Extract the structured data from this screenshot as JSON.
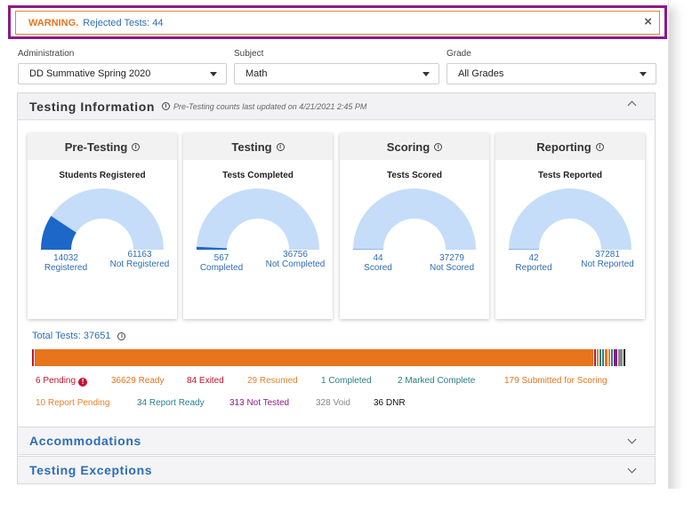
{
  "warning": {
    "label": "WARNING.",
    "message": "Rejected Tests: 44",
    "close_icon": "×"
  },
  "filters": [
    {
      "label": "Administration",
      "value": "DD Summative Spring 2020"
    },
    {
      "label": "Subject",
      "value": "Math"
    },
    {
      "label": "Grade",
      "value": "All Grades"
    }
  ],
  "testing_info": {
    "title": "Testing Information",
    "note": "Pre-Testing counts last updated on 4/21/2021 2:45 PM",
    "info_icon": "i",
    "cards": [
      {
        "title": "Pre-Testing",
        "subtitle": "Students Registered",
        "fraction": 0.1855,
        "left_value": "14032",
        "left_label": "Registered",
        "right_value": "61163",
        "right_label": "Not Registered"
      },
      {
        "title": "Testing",
        "subtitle": "Tests Completed",
        "fraction": 0.0152,
        "left_value": "567",
        "left_label": "Completed",
        "right_value": "36756",
        "right_label": "Not Completed"
      },
      {
        "title": "Scoring",
        "subtitle": "Tests Scored",
        "fraction": 0.0012,
        "left_value": "44",
        "left_label": "Scored",
        "right_value": "37279",
        "right_label": "Not Scored"
      },
      {
        "title": "Reporting",
        "subtitle": "Tests Reported",
        "fraction": 0.0011,
        "left_value": "42",
        "left_label": "Reported",
        "right_value": "37281",
        "right_label": "Not Reported"
      }
    ],
    "total_label": "Total Tests: 37651",
    "status_items": [
      {
        "count": 6,
        "label": "6 Pending",
        "color": "#c41230",
        "alert": true
      },
      {
        "count": 36629,
        "label": "36629 Ready",
        "color": "#e8741c"
      },
      {
        "count": 84,
        "label": "84 Exited",
        "color": "#c41230"
      },
      {
        "count": 29,
        "label": "29 Resumed",
        "color": "#e8822a"
      },
      {
        "count": 1,
        "label": "1 Completed",
        "color": "#2a7f88"
      },
      {
        "count": 2,
        "label": "2 Marked Complete",
        "color": "#2a7f88"
      },
      {
        "count": 179,
        "label": "179 Submitted for Scoring",
        "color": "#e8741c"
      },
      {
        "count": 10,
        "label": "10 Report Pending",
        "color": "#e8822a"
      },
      {
        "count": 34,
        "label": "34 Report Ready",
        "color": "#2a7f88"
      },
      {
        "count": 313,
        "label": "313 Not Tested",
        "color": "#8b1a86"
      },
      {
        "count": 328,
        "label": "328 Void",
        "color": "#888888"
      },
      {
        "count": 36,
        "label": "36 DNR",
        "color": "#111111"
      }
    ]
  },
  "sections": [
    {
      "title": "Accommodations"
    },
    {
      "title": "Testing Exceptions"
    }
  ],
  "colors": {
    "gauge_fill": "#1c67c7",
    "gauge_track": "#c5ddf8",
    "accent": "#2d6db5",
    "warning": "#e8741c",
    "highlight": "#8b1a86"
  }
}
